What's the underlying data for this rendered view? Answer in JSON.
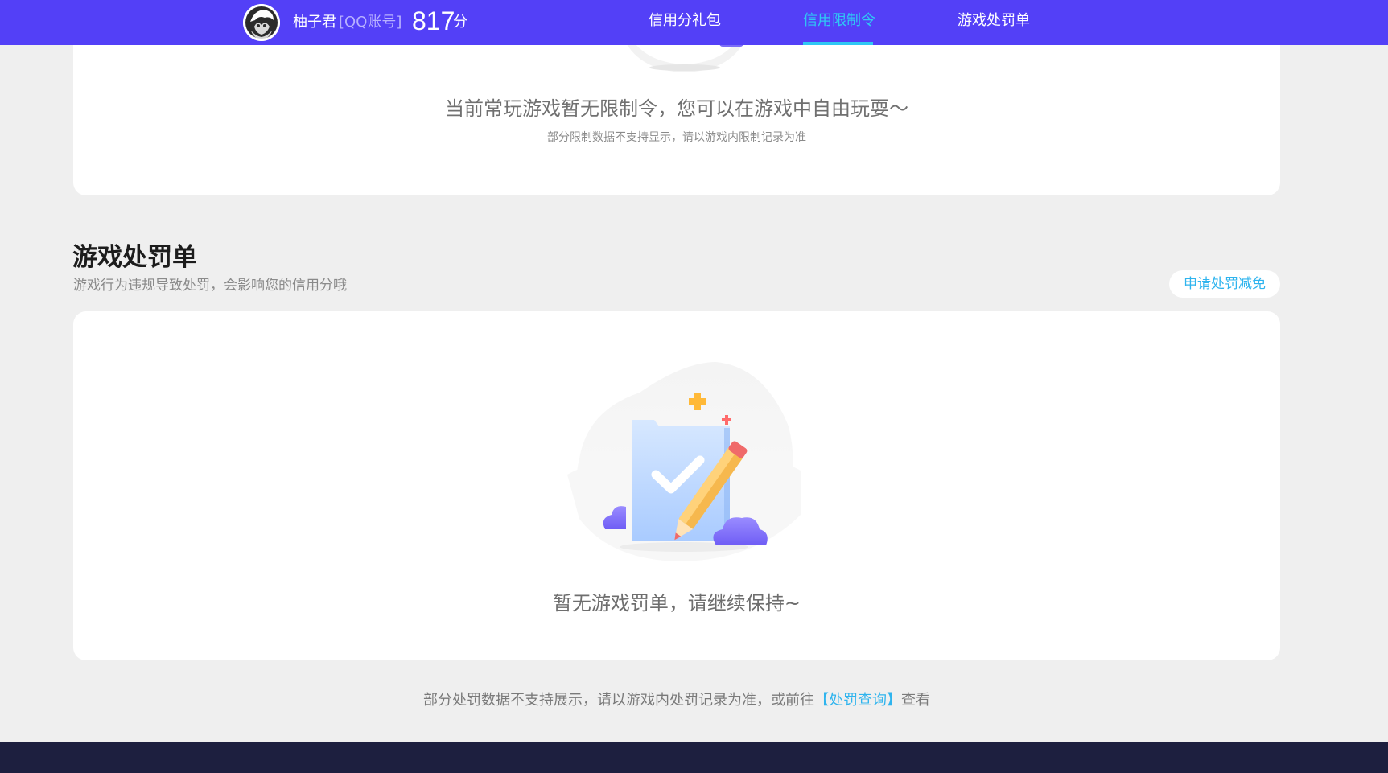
{
  "header": {
    "user_name": "柚子君",
    "account_type": "[QQ账号]",
    "score": "817",
    "score_unit": "分",
    "tabs": [
      {
        "label": "信用分礼包",
        "active": false
      },
      {
        "label": "信用限制令",
        "active": true
      },
      {
        "label": "游戏处罚单",
        "active": false
      }
    ],
    "brand_color": "#5340f7",
    "active_color": "#2fc8f4"
  },
  "restrict_section": {
    "empty_text": "当前常玩游戏暂无限制令，您可以在游戏中自由玩耍～",
    "note": "部分限制数据不支持显示，请以游戏内限制记录为准"
  },
  "penalty_section": {
    "title": "游戏处罚单",
    "subtitle": "游戏行为违规导致处罚，会影响您的信用分哦",
    "apply_button": "申请处罚减免",
    "empty_text": "暂无游戏罚单，请继续保持~",
    "illustration_icon": "document-check-pencil-icon"
  },
  "footer": {
    "note_before": "部分处罚数据不支持展示，请以游戏内处罚记录为准，或前往",
    "link_text": "【处罚查询】",
    "note_after": "查看"
  }
}
